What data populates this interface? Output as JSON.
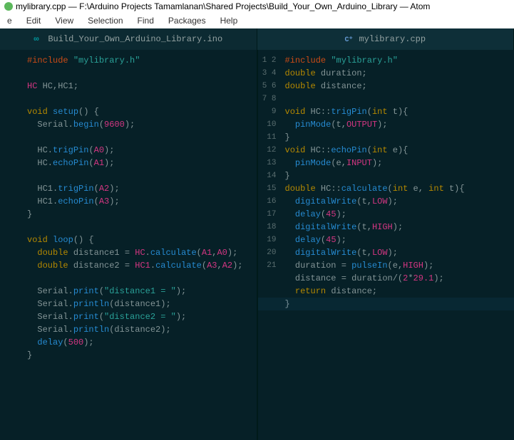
{
  "window": {
    "title": "mylibrary.cpp — F:\\Arduino Projects Tamamlanan\\Shared Projects\\Build_Your_Own_Arduino_Library — Atom"
  },
  "menu": {
    "items": [
      "e",
      "Edit",
      "View",
      "Selection",
      "Find",
      "Packages",
      "Help"
    ]
  },
  "tabs": {
    "left": {
      "label": "Build_Your_Own_Arduino_Library.ino",
      "icon": "arduino"
    },
    "right": {
      "label": "mylibrary.cpp",
      "icon": "cpp"
    }
  },
  "left_pane": {
    "lines": [
      {
        "tokens": [
          [
            "dir",
            "#include"
          ],
          [
            "id",
            " "
          ],
          [
            "str",
            "\"mylibrary.h\""
          ]
        ]
      },
      {
        "tokens": []
      },
      {
        "tokens": [
          [
            "type",
            "HC"
          ],
          [
            "id",
            " HC,HC1;"
          ]
        ]
      },
      {
        "tokens": []
      },
      {
        "tokens": [
          [
            "kw",
            "void"
          ],
          [
            "id",
            " "
          ],
          [
            "fn",
            "setup"
          ],
          [
            "id",
            "() {"
          ]
        ]
      },
      {
        "tokens": [
          [
            "id",
            "  Serial."
          ],
          [
            "fn",
            "begin"
          ],
          [
            "id",
            "("
          ],
          [
            "num",
            "9600"
          ],
          [
            "id",
            ");"
          ]
        ]
      },
      {
        "tokens": []
      },
      {
        "tokens": [
          [
            "id",
            "  HC."
          ],
          [
            "fn",
            "trigPin"
          ],
          [
            "id",
            "("
          ],
          [
            "num",
            "A0"
          ],
          [
            "id",
            ");"
          ]
        ]
      },
      {
        "tokens": [
          [
            "id",
            "  HC."
          ],
          [
            "fn",
            "echoPin"
          ],
          [
            "id",
            "("
          ],
          [
            "num",
            "A1"
          ],
          [
            "id",
            ");"
          ]
        ]
      },
      {
        "tokens": []
      },
      {
        "tokens": [
          [
            "id",
            "  HC1."
          ],
          [
            "fn",
            "trigPin"
          ],
          [
            "id",
            "("
          ],
          [
            "num",
            "A2"
          ],
          [
            "id",
            ");"
          ]
        ]
      },
      {
        "tokens": [
          [
            "id",
            "  HC1."
          ],
          [
            "fn",
            "echoPin"
          ],
          [
            "id",
            "("
          ],
          [
            "num",
            "A3"
          ],
          [
            "id",
            ");"
          ]
        ]
      },
      {
        "tokens": [
          [
            "id",
            "}"
          ]
        ]
      },
      {
        "tokens": []
      },
      {
        "tokens": [
          [
            "kw",
            "void"
          ],
          [
            "id",
            " "
          ],
          [
            "fn",
            "loop"
          ],
          [
            "id",
            "() {"
          ]
        ]
      },
      {
        "tokens": [
          [
            "id",
            "  "
          ],
          [
            "kw",
            "double"
          ],
          [
            "id",
            " distance1 = "
          ],
          [
            "type",
            "HC"
          ],
          [
            "id",
            "."
          ],
          [
            "fn",
            "calculate"
          ],
          [
            "id",
            "("
          ],
          [
            "num",
            "A1"
          ],
          [
            "id",
            ","
          ],
          [
            "num",
            "A0"
          ],
          [
            "id",
            ");"
          ]
        ]
      },
      {
        "tokens": [
          [
            "id",
            "  "
          ],
          [
            "kw",
            "double"
          ],
          [
            "id",
            " distance2 = "
          ],
          [
            "type",
            "HC1"
          ],
          [
            "id",
            "."
          ],
          [
            "fn",
            "calculate"
          ],
          [
            "id",
            "("
          ],
          [
            "num",
            "A3"
          ],
          [
            "id",
            ","
          ],
          [
            "num",
            "A2"
          ],
          [
            "id",
            ");"
          ]
        ]
      },
      {
        "tokens": []
      },
      {
        "tokens": [
          [
            "id",
            "  Serial."
          ],
          [
            "fn",
            "print"
          ],
          [
            "id",
            "("
          ],
          [
            "str",
            "\"distance1 = \""
          ],
          [
            "id",
            ");"
          ]
        ]
      },
      {
        "tokens": [
          [
            "id",
            "  Serial."
          ],
          [
            "fn",
            "println"
          ],
          [
            "id",
            "(distance1);"
          ]
        ]
      },
      {
        "tokens": [
          [
            "id",
            "  Serial."
          ],
          [
            "fn",
            "print"
          ],
          [
            "id",
            "("
          ],
          [
            "str",
            "\"distance2 = \""
          ],
          [
            "id",
            ");"
          ]
        ]
      },
      {
        "tokens": [
          [
            "id",
            "  Serial."
          ],
          [
            "fn",
            "println"
          ],
          [
            "id",
            "(distance2);"
          ]
        ]
      },
      {
        "tokens": [
          [
            "id",
            "  "
          ],
          [
            "fn",
            "delay"
          ],
          [
            "id",
            "("
          ],
          [
            "num",
            "500"
          ],
          [
            "id",
            ");"
          ]
        ]
      },
      {
        "tokens": [
          [
            "id",
            "}"
          ]
        ]
      }
    ]
  },
  "right_pane": {
    "start_line": 1,
    "cursor_line": 20,
    "lines": [
      {
        "tokens": [
          [
            "dir",
            "#include"
          ],
          [
            "id",
            " "
          ],
          [
            "str",
            "\"mylibrary.h\""
          ]
        ]
      },
      {
        "tokens": [
          [
            "kw",
            "double"
          ],
          [
            "id",
            " duration;"
          ]
        ]
      },
      {
        "tokens": [
          [
            "kw",
            "double"
          ],
          [
            "id",
            " distance;"
          ]
        ]
      },
      {
        "tokens": []
      },
      {
        "tokens": [
          [
            "kw",
            "void"
          ],
          [
            "id",
            " HC::"
          ],
          [
            "fn",
            "trigPin"
          ],
          [
            "id",
            "("
          ],
          [
            "kw",
            "int"
          ],
          [
            "id",
            " t){"
          ]
        ]
      },
      {
        "tokens": [
          [
            "id",
            "  "
          ],
          [
            "fn",
            "pinMode"
          ],
          [
            "id",
            "(t,"
          ],
          [
            "num",
            "OUTPUT"
          ],
          [
            "id",
            ");"
          ]
        ]
      },
      {
        "tokens": [
          [
            "id",
            "}"
          ]
        ]
      },
      {
        "tokens": [
          [
            "kw",
            "void"
          ],
          [
            "id",
            " HC::"
          ],
          [
            "fn",
            "echoPin"
          ],
          [
            "id",
            "("
          ],
          [
            "kw",
            "int"
          ],
          [
            "id",
            " e){"
          ]
        ]
      },
      {
        "tokens": [
          [
            "id",
            "  "
          ],
          [
            "fn",
            "pinMode"
          ],
          [
            "id",
            "(e,"
          ],
          [
            "num",
            "INPUT"
          ],
          [
            "id",
            ");"
          ]
        ]
      },
      {
        "tokens": [
          [
            "id",
            "}"
          ]
        ]
      },
      {
        "tokens": [
          [
            "kw",
            "double"
          ],
          [
            "id",
            " HC::"
          ],
          [
            "fn",
            "calculate"
          ],
          [
            "id",
            "("
          ],
          [
            "kw",
            "int"
          ],
          [
            "id",
            " e, "
          ],
          [
            "kw",
            "int"
          ],
          [
            "id",
            " t){"
          ]
        ]
      },
      {
        "tokens": [
          [
            "id",
            "  "
          ],
          [
            "fn",
            "digitalWrite"
          ],
          [
            "id",
            "(t,"
          ],
          [
            "num",
            "LOW"
          ],
          [
            "id",
            ");"
          ]
        ]
      },
      {
        "tokens": [
          [
            "id",
            "  "
          ],
          [
            "fn",
            "delay"
          ],
          [
            "id",
            "("
          ],
          [
            "num",
            "45"
          ],
          [
            "id",
            ");"
          ]
        ]
      },
      {
        "tokens": [
          [
            "id",
            "  "
          ],
          [
            "fn",
            "digitalWrite"
          ],
          [
            "id",
            "(t,"
          ],
          [
            "num",
            "HIGH"
          ],
          [
            "id",
            ");"
          ]
        ]
      },
      {
        "tokens": [
          [
            "id",
            "  "
          ],
          [
            "fn",
            "delay"
          ],
          [
            "id",
            "("
          ],
          [
            "num",
            "45"
          ],
          [
            "id",
            ");"
          ]
        ]
      },
      {
        "tokens": [
          [
            "id",
            "  "
          ],
          [
            "fn",
            "digitalWrite"
          ],
          [
            "id",
            "(t,"
          ],
          [
            "num",
            "LOW"
          ],
          [
            "id",
            ");"
          ]
        ]
      },
      {
        "tokens": [
          [
            "id",
            "  duration = "
          ],
          [
            "fn",
            "pulseIn"
          ],
          [
            "id",
            "(e,"
          ],
          [
            "num",
            "HIGH"
          ],
          [
            "id",
            ");"
          ]
        ]
      },
      {
        "tokens": [
          [
            "id",
            "  distance = duration/("
          ],
          [
            "num",
            "2"
          ],
          [
            "id",
            "*"
          ],
          [
            "num",
            "29.1"
          ],
          [
            "id",
            ");"
          ]
        ]
      },
      {
        "tokens": [
          [
            "id",
            "  "
          ],
          [
            "kw",
            "return"
          ],
          [
            "id",
            " distance;"
          ]
        ]
      },
      {
        "tokens": [
          [
            "id",
            "}"
          ]
        ]
      },
      {
        "tokens": []
      }
    ]
  }
}
